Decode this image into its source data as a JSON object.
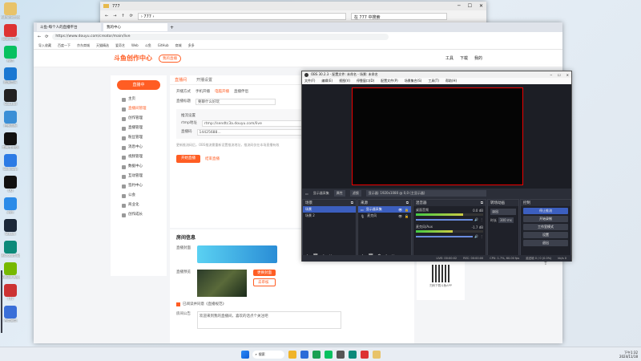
{
  "desktop": {
    "icons": [
      {
        "label": "Administrator",
        "color": "#e8c36a"
      },
      {
        "label": "网易云音乐",
        "color": "#d33"
      },
      {
        "label": "微信",
        "color": "#07c160"
      },
      {
        "label": "酷狗音乐",
        "color": "#1a78d2"
      },
      {
        "label": "GoLand",
        "color": "#222"
      },
      {
        "label": "控制面板",
        "color": "#3b8fd6"
      },
      {
        "label": "剪映专业版",
        "color": "#111"
      },
      {
        "label": "Bandizip",
        "color": "#2c7be5"
      },
      {
        "label": "QQ",
        "color": "#111"
      },
      {
        "label": "必应",
        "color": "#2b8be8"
      },
      {
        "label": "Steam",
        "color": "#1b2838"
      },
      {
        "label": "Microsoft Edge",
        "color": "#0c8a7a"
      },
      {
        "label": "NVIDIA App",
        "color": "#76b900"
      },
      {
        "label": "777",
        "color": "#c33"
      },
      {
        "label": "百度网盘",
        "color": "#3a6fd8"
      }
    ]
  },
  "explorer": {
    "title": "777",
    "crumb": "777",
    "search": "在 777 中搜索"
  },
  "browser": {
    "tab1": "斗鱼-每个人的直播平台",
    "tab2": "我的中心",
    "url": "https://www.douyu.com/creator/main/live",
    "bookmarks": [
      "导入收藏",
      "百度一下",
      "京东商城",
      "天猫精选",
      "爱奇艺",
      "Web",
      "斗鱼",
      "GitHub",
      "商城",
      "多多"
    ],
    "logo": "斗鱼创作中心",
    "badge": "我的直播",
    "header_icons": [
      "工具",
      "下载",
      "我的"
    ],
    "live_btn": "直播中",
    "sidebar": [
      "主页",
      "直播间管理",
      "创作管理",
      "直播管理",
      "粉丝管理",
      "消息中心",
      "视频管理",
      "数据中心",
      "互动管理",
      "签约中心",
      "公会",
      "商业化",
      "创作成长"
    ],
    "tabs": [
      "直播间",
      "开播设置"
    ],
    "form": {
      "mode_label": "开播方式",
      "mode_options": [
        "手机开播",
        "电脑开播",
        "直播伴侣"
      ],
      "title_label": "直播标题",
      "title_value": "要聊什么好玩",
      "tool_label": "推流设置",
      "server_label": "rtmp地址",
      "server_value": "rtmp://sendtc3a.douyu.com/live",
      "key_label": "直播码",
      "key_value": "14425688...",
      "hint": "更新推流码后，OBS推流需重新设置推流地址，推流码仅在本场直播有效",
      "start": "开始直播",
      "stop_link": "结束直播",
      "info_title": "房间信息",
      "cover_label": "直播封面",
      "preview_label": "直播预览",
      "cover_btn1": "更换封面",
      "cover_btn2": "去审核",
      "notice_label": "房间公告",
      "notice_value": "欢迎来到我的直播间，喜欢的话点个关注吧",
      "agree": "已阅读并同意《直播规范》"
    }
  },
  "obs": {
    "title": "OBS 30.2.3 - 配置文件: 未命名 - 场景: 未命名",
    "menus": [
      "文件(F)",
      "编辑(E)",
      "视图(V)",
      "停靠窗口(D)",
      "配置文件(P)",
      "场景集合(S)",
      "工具(T)",
      "帮助(H)"
    ],
    "source_bar": [
      "显示器采集",
      "属性",
      "滤镜",
      "显示器: 1920x1080 @ 0,0 (主显示器)"
    ],
    "scenes": {
      "title": "场景",
      "items": [
        "场景",
        "场景 2"
      ]
    },
    "sources": {
      "title": "来源",
      "items": [
        "显示器采集",
        "麦克风"
      ]
    },
    "mixer": {
      "title": "混音器",
      "tracks": [
        {
          "name": "桌面音频",
          "db": "0.0 dB",
          "level": 0.7
        },
        {
          "name": "麦克风/Aux",
          "db": "-1.7 dB",
          "level": 0.55
        }
      ]
    },
    "transitions": {
      "title": "转场动画",
      "type": "淡出",
      "duration_label": "时长",
      "duration": "300 ms"
    },
    "controls": {
      "title": "控制",
      "buttons": [
        "停止推流",
        "开始录制",
        "工作室模式",
        "设置",
        "退出"
      ]
    },
    "status": [
      "LIVE: 00:00:02",
      "REC: 00:00:00",
      "CPU: 1.7%, 60.00 fps",
      "延迟帧 0 / 0 (0.0%)",
      "kb/s 0"
    ]
  },
  "qr_caption": "扫码下载斗鱼APP",
  "taskbar": {
    "search": "搜索",
    "time": "下午1:32",
    "date": "2024/11/18"
  }
}
